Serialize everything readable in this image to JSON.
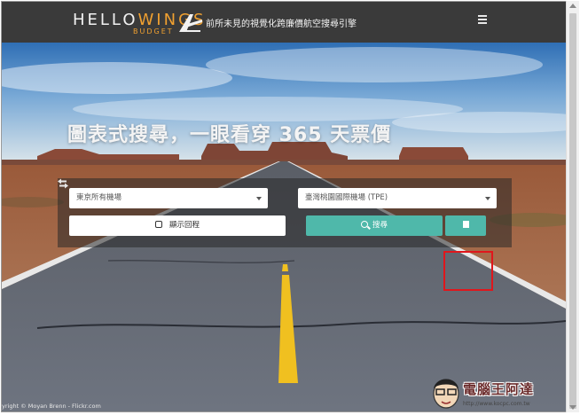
{
  "header": {
    "logo_main_a": "HELLO",
    "logo_main_b": "WINGS",
    "logo_sub": "BUDGET",
    "tagline": "前所未見的視覺化跨廉價航空搜尋引擎",
    "menu_icon": "hamburger-menu-icon"
  },
  "hero": {
    "headline": "圖表式搜尋，一眼看穿 365 天票價"
  },
  "search": {
    "origin": "東京所有機場",
    "destination": "臺灣桃園國際機場 (TPE)",
    "roundtrip_label": "顯示回程",
    "search_label": "搜尋",
    "swap_icon": "swap-arrows-icon",
    "calendar_icon": "calendar-icon",
    "search_icon": "magnifier-icon"
  },
  "footer": {
    "credit": "yright © Moyan Brenn - Flickr.com",
    "watermark": "電腦王阿達",
    "watermark_url": "http://www.kocpc.com.tw"
  },
  "colors": {
    "header_bg": "#3a3a3a",
    "accent": "#f0a030",
    "button_teal": "#4fb8aa",
    "highlight": "#e0161c"
  }
}
